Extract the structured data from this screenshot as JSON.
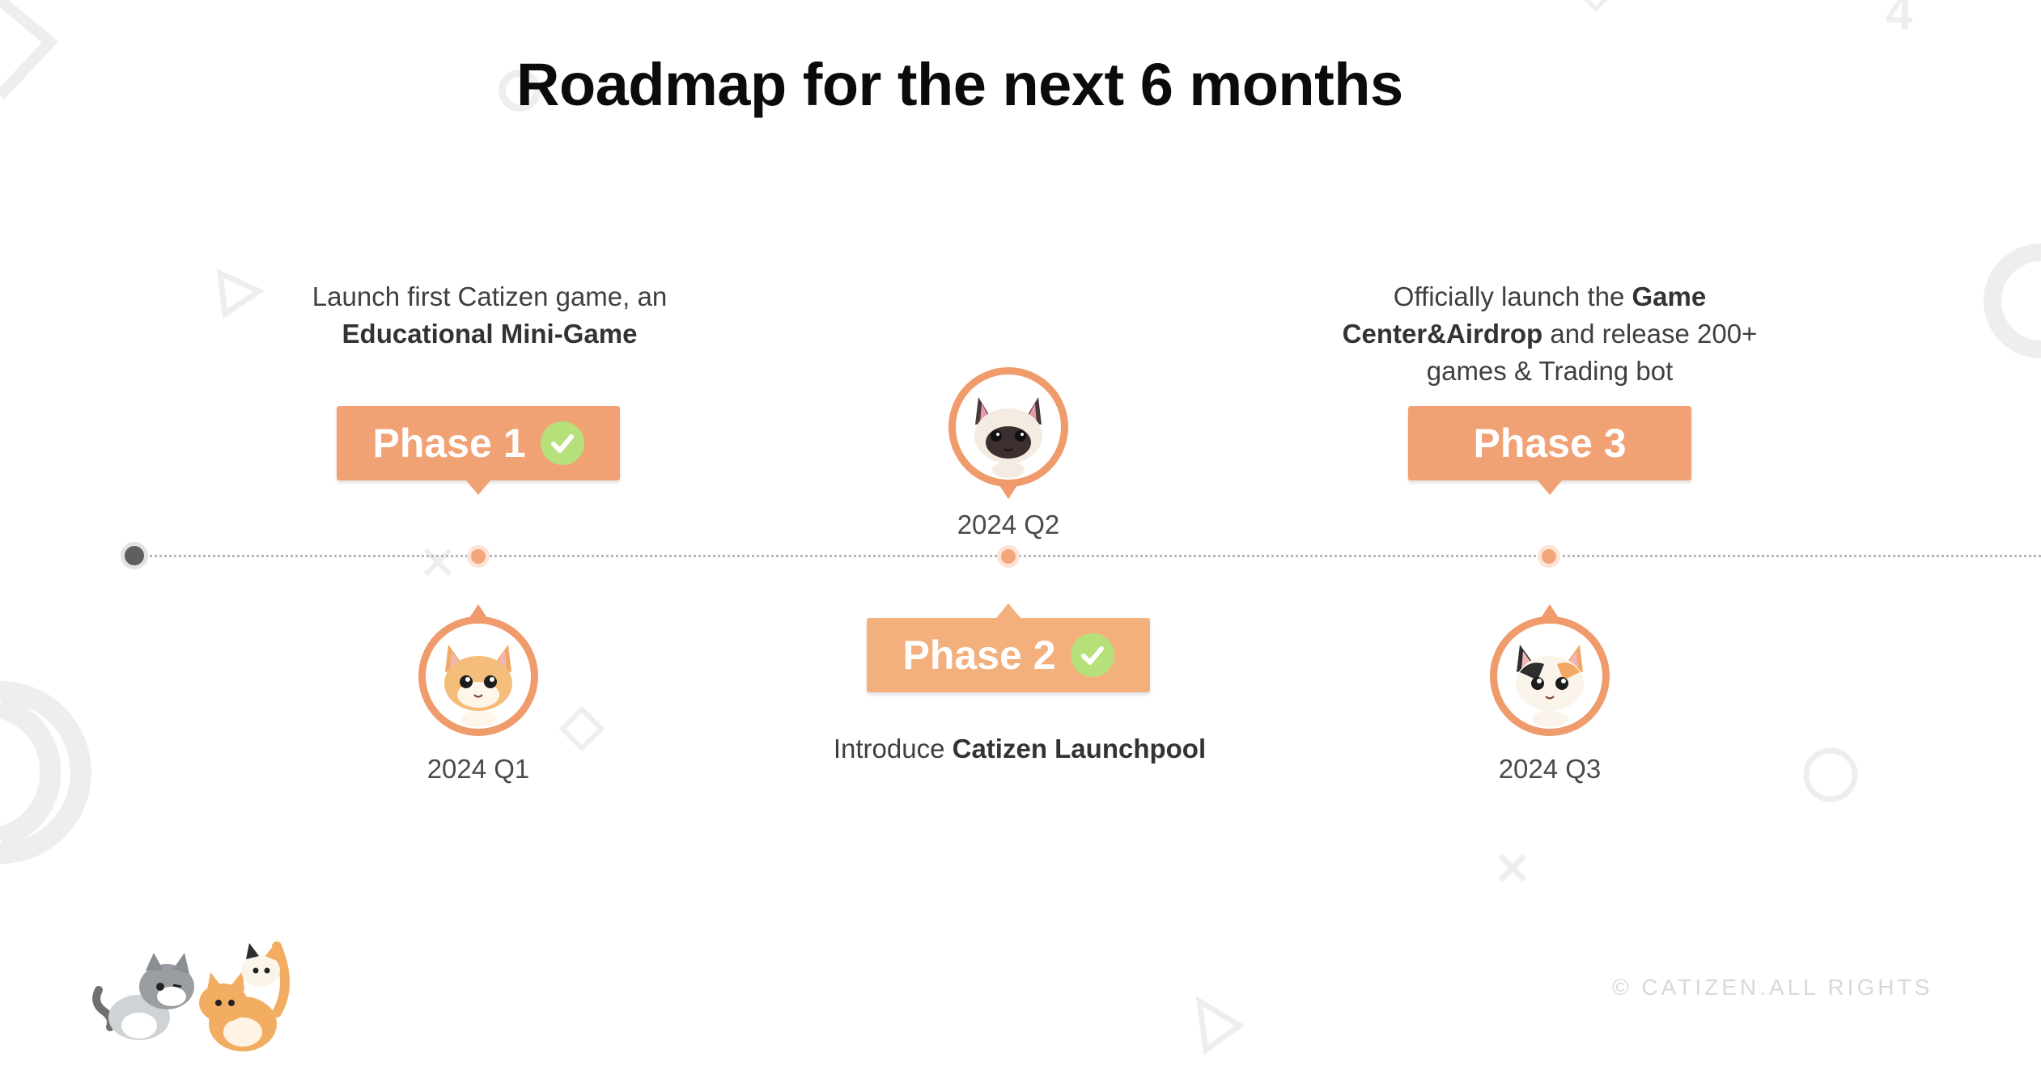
{
  "title": "Roadmap for the next 6 months",
  "phases": [
    {
      "label": "Phase 1",
      "completed": true,
      "date": "2024 Q1",
      "description_lead": "Launch first Catizen game, an",
      "description_bold": "Educational Mini-Game",
      "avatar": "orange-cat-avatar"
    },
    {
      "label": "Phase 2",
      "completed": true,
      "date": "2024 Q2",
      "description_lead": "Introduce",
      "description_bold": "Catizen Launchpool",
      "avatar": "siamese-cat-avatar"
    },
    {
      "label": "Phase 3",
      "completed": false,
      "date": "2024 Q3",
      "description_lead": "Officially launch the",
      "description_bold": "Game Center&Airdrop",
      "description_tail": "and release 200+ games & Trading bot",
      "avatar": "calico-cat-avatar"
    }
  ],
  "footer": {
    "copyright": "© CATIZEN.ALL RIGHTS"
  },
  "colors": {
    "accent": "#f0a274",
    "check": "#b6e07a",
    "timeline_dot": "#f3a67a"
  }
}
